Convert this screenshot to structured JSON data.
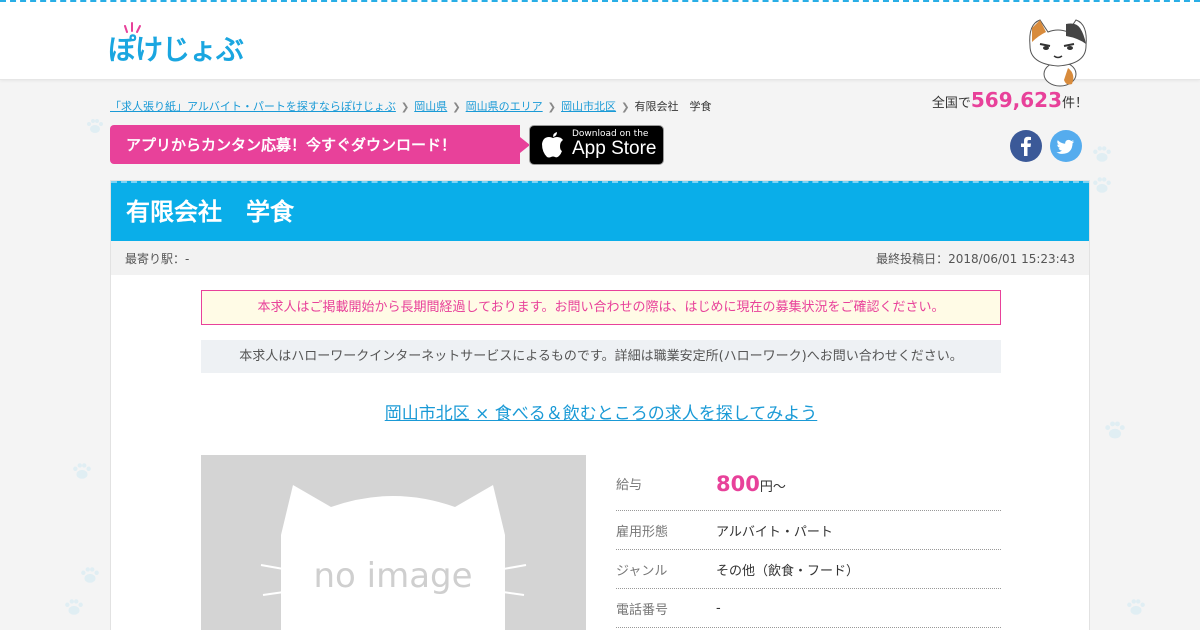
{
  "header": {
    "logo_text": "ぽけじょぶ",
    "total_prefix": "全国で",
    "total_count": "569,623",
    "total_suffix": "件！"
  },
  "breadcrumb": [
    "「求人張り紙」アルバイト・パートを探すならぽけじょぶ",
    "岡山県",
    "岡山県のエリア",
    "岡山市北区",
    "有限会社　学食"
  ],
  "app_banner": {
    "text": "アプリからカンタン応募！今すぐダウンロード！",
    "store_small": "Download on the",
    "store_big": "App Store"
  },
  "social": [
    "facebook-icon",
    "twitter-icon"
  ],
  "job": {
    "title": "有限会社　学食",
    "station": "最寄り駅：-",
    "posted": "最終投稿日：2018/06/01 15:23:43",
    "notice_expired": "本求人はご掲載開始から長期間経過しております。お問い合わせの際は、はじめに現在の募集状況をご確認ください。",
    "notice_hellowork": "本求人はハローワークインターネットサービスによるものです。詳細は職業安定所(ハローワーク)へお問い合わせください。",
    "search_link": "岡山市北区 × 食べる＆飲むところの求人を探してみよう",
    "noimage_text": "no image",
    "salary_label": "給与",
    "salary_amount": "800",
    "salary_unit": "円～",
    "rows": [
      {
        "label": "雇用形態",
        "value": "アルバイト・パート"
      },
      {
        "label": "ジャンル",
        "value": "その他（飲食・フード）"
      },
      {
        "label": "電話番号",
        "value": "-"
      }
    ]
  },
  "colors": {
    "brand_blue": "#0aaee9",
    "brand_pink": "#e8419a"
  }
}
